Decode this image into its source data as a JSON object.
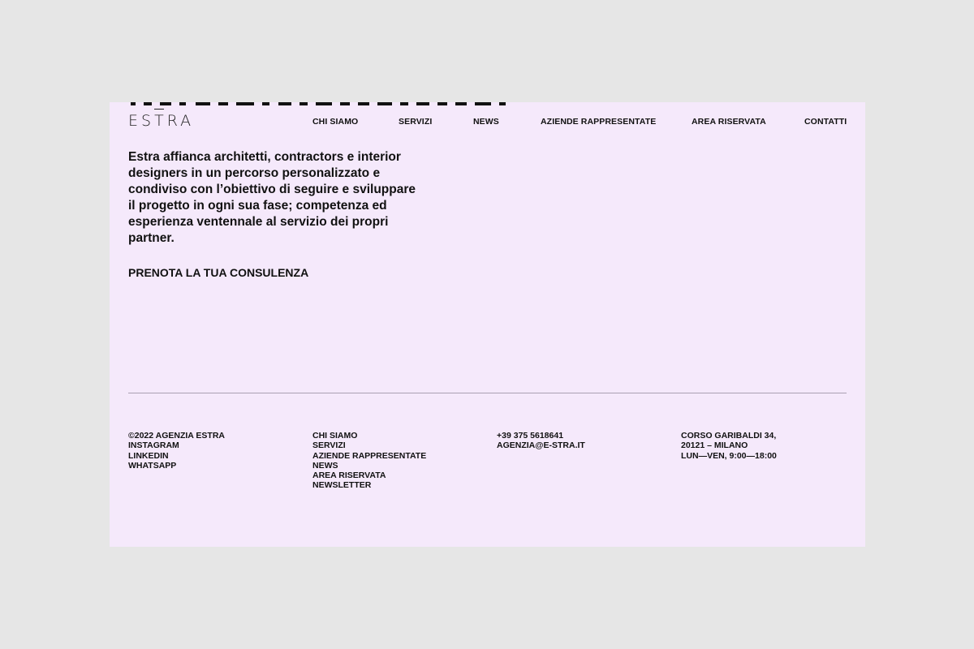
{
  "header": {
    "logo_text": "ESTRA",
    "nav": [
      "CHI SIAMO",
      "SERVIZI",
      "NEWS",
      "AZIENDE RAPPRESENTATE",
      "AREA RISERVATA",
      "CONTATTI"
    ]
  },
  "main": {
    "intro": "Estra affianca architetti, contractors e interior designers in un percorso personalizzato e condiviso con l’obiettivo di seguire e sviluppare il progetto in ogni sua fase; competenza ed esperienza ventennale al servizio dei propri partner.",
    "cta": "PRENOTA LA TUA CONSULENZA"
  },
  "footer": {
    "col1": [
      "©2022 AGENZIA ESTRA",
      "INSTAGRAM",
      "LINKEDIN",
      "WHATSAPP"
    ],
    "col2": [
      "CHI SIAMO",
      "SERVIZI",
      "AZIENDE RAPPRESENTATE",
      "NEWS",
      "AREA RISERVATA",
      "NEWSLETTER"
    ],
    "col3": [
      "+39 375 5618641",
      "AGENZIA@E-STRA.IT"
    ],
    "col4": [
      "CORSO GARIBALDI 34,",
      "20121 – MILANO",
      "LUN—VEN, 9:00—18:00"
    ]
  },
  "colors": {
    "page_background": "#e6e6e6",
    "panel_background": "#f5e9fb",
    "text": "#111111",
    "divider": "#aaa1b3"
  }
}
